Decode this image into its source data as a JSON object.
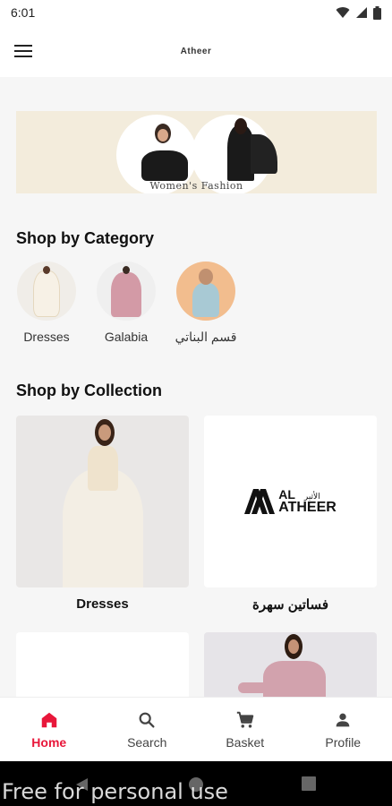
{
  "status_bar": {
    "time": "6:01",
    "icons": [
      "wifi-icon",
      "signal-icon",
      "battery-icon"
    ]
  },
  "app_bar": {
    "logo_text": "Atheer"
  },
  "banner": {
    "caption": "Women's Fashion"
  },
  "categories": {
    "title": "Shop by Category",
    "items": [
      {
        "label": "Dresses"
      },
      {
        "label": "Galabia"
      },
      {
        "label": "قسم البناتي"
      }
    ]
  },
  "collections": {
    "title": "Shop by Collection",
    "items": [
      {
        "label": "Dresses"
      },
      {
        "label": "فساتين سهرة",
        "logo_line1": "AL",
        "logo_line2": "ATHEER",
        "logo_arabic": "الأثير"
      }
    ]
  },
  "bottom_nav": {
    "items": [
      {
        "label": "Home",
        "icon": "home-icon",
        "active": true
      },
      {
        "label": "Search",
        "icon": "search-icon",
        "active": false
      },
      {
        "label": "Basket",
        "icon": "cart-icon",
        "active": false
      },
      {
        "label": "Profile",
        "icon": "person-icon",
        "active": false
      }
    ]
  },
  "colors": {
    "accent": "#e8173a",
    "banner_bg": "#f3ecdc"
  },
  "watermark": "Free for personal use"
}
